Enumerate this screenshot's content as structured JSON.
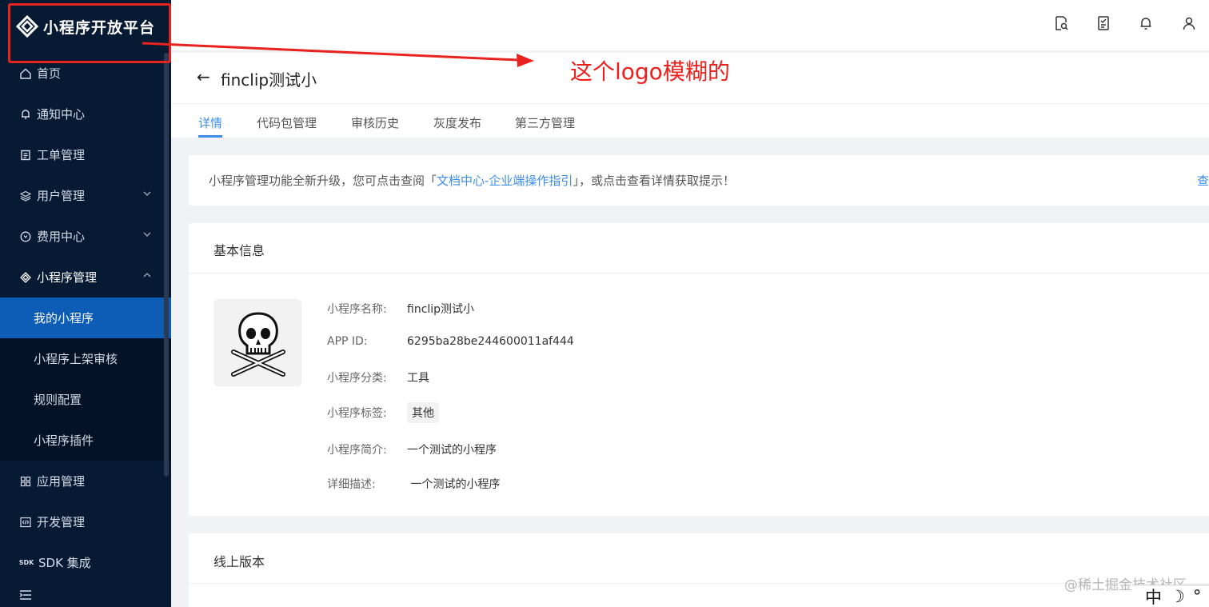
{
  "logo": {
    "text": "小程序开放平台"
  },
  "sidebar": {
    "items": [
      {
        "label": "首页",
        "icon": "home-icon"
      },
      {
        "label": "通知中心",
        "icon": "bell-icon"
      },
      {
        "label": "工单管理",
        "icon": "clipboard-icon"
      },
      {
        "label": "用户管理",
        "icon": "layers-icon",
        "expandable": true
      },
      {
        "label": "费用中心",
        "icon": "coin-icon",
        "expandable": true
      },
      {
        "label": "小程序管理",
        "icon": "diamond-icon",
        "expanded": true
      }
    ],
    "sub_items": [
      {
        "label": "我的小程序",
        "active": true
      },
      {
        "label": "小程序上架审核"
      },
      {
        "label": "规则配置"
      },
      {
        "label": "小程序插件"
      }
    ],
    "items_after": [
      {
        "label": "应用管理",
        "icon": "grid-icon"
      },
      {
        "label": "开发管理",
        "icon": "code-icon"
      },
      {
        "label": "SDK 集成",
        "icon": "sdk-icon"
      }
    ]
  },
  "header": {
    "icons": [
      "search-doc-icon",
      "document-icon",
      "bell-icon",
      "user-icon"
    ]
  },
  "page": {
    "back_arrow": "←",
    "title": "finclip测试小",
    "tabs": [
      "详情",
      "代码包管理",
      "审核历史",
      "灰度发布",
      "第三方管理"
    ],
    "active_tab": 0
  },
  "notice": {
    "prefix": "小程序管理功能全新升级，您可点击查阅「",
    "link": " 文档中心-企业端操作指引 ",
    "suffix": "」，或点击查看详情获取提示！",
    "right_link": "查"
  },
  "basic_info": {
    "title": "基本信息",
    "rows": [
      {
        "label": "小程序名称:",
        "value": "finclip测试小"
      },
      {
        "label": "APP ID:",
        "value": "6295ba28be244600011af444"
      },
      {
        "label": "小程序分类:",
        "value": "工具"
      },
      {
        "label": "小程序标签:",
        "value": "其他"
      },
      {
        "label": "小程序简介:",
        "value": "一个测试的小程序"
      },
      {
        "label": "详细描述:",
        "value": " 一个测试的小程序"
      }
    ]
  },
  "online_version": {
    "title": "线上版本"
  },
  "annotation": {
    "text": "这个logo模糊的",
    "color": "#ee1f1c"
  },
  "watermark": "@稀土掘金技术社区",
  "ime": {
    "lang": "中",
    "moon": "☽",
    "dot": "°"
  },
  "colors": {
    "sidebar_bg": "#061a33",
    "accent": "#3c8ee8",
    "active_menu": "#0d5db6"
  }
}
